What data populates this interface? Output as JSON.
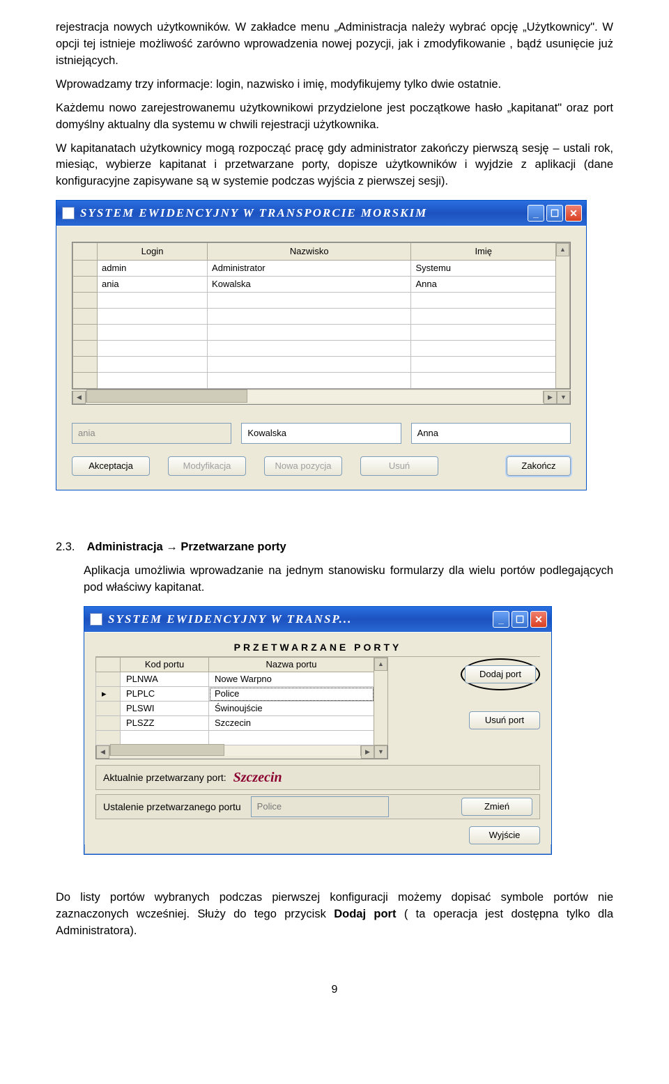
{
  "para1": "rejestracja nowych użytkowników. W zakładce menu „Administracja należy wybrać opcję „Użytkownicy\". W opcji tej istnieje możliwość zarówno wprowadzenia nowej pozycji, jak i zmodyfikowanie , bądź usunięcie już istniejących.",
  "para2": "Wprowadzamy trzy informacje:  login, nazwisko i imię, modyfikujemy tylko dwie ostatnie.",
  "para3": " Każdemu nowo zarejestrowanemu użytkownikowi przydzielone jest początkowe  hasło „kapitanat\" oraz port domyślny aktualny dla systemu w chwili rejestracji użytkownika.",
  "para4": "  W kapitanatach użytkownicy mogą rozpocząć pracę gdy administrator zakończy pierwszą sesję – ustali rok, miesiąc, wybierze kapitanat i przetwarzane porty, dopisze użytkowników  i wyjdzie z aplikacji (dane konfiguracyjne zapisywane są w systemie podczas  wyjścia z pierwszej sesji).",
  "win1": {
    "title": "SYSTEM  EWIDENCYJNY  W  TRANSPORCIE  MORSKIM",
    "cols": [
      "Login",
      "Nazwisko",
      "Imię"
    ],
    "rows": [
      {
        "login": "admin",
        "nazwisko": "Administrator",
        "imie": "Systemu"
      },
      {
        "login": "ania",
        "nazwisko": "Kowalska",
        "imie": "Anna"
      }
    ],
    "edit": {
      "login": "ania",
      "nazwisko": "Kowalska",
      "imie": "Anna"
    },
    "btns": {
      "accept": "Akceptacja",
      "modify": "Modyfikacja",
      "new": "Nowa pozycja",
      "del": "Usuń",
      "close": "Zakończ"
    }
  },
  "sect": {
    "num": "2.3.",
    "title": "Administracja → Przetwarzane porty",
    "body": "Aplikacja umożliwia wprowadzanie na jednym stanowisku formularzy dla wielu portów podlegających pod właściwy kapitanat."
  },
  "win2": {
    "title": "SYSTEM  EWIDENCYJNY  W  TRANSP...",
    "heading": "PRZETWARZANE PORTY",
    "cols": [
      "Kod portu",
      "Nazwa portu"
    ],
    "rows": [
      {
        "kod": "PLNWA",
        "nazwa": "Nowe Warpno"
      },
      {
        "kod": "PLPLC",
        "nazwa": "Police"
      },
      {
        "kod": "PLSWI",
        "nazwa": "Świnoujście"
      },
      {
        "kod": "PLSZZ",
        "nazwa": "Szczecin"
      }
    ],
    "btns": {
      "add": "Dodaj port",
      "del": "Usuń port",
      "change": "Zmień",
      "exit": "Wyjście"
    },
    "cur_lbl": "Aktualnie przetwarzany port:",
    "cur_val": "Szczecin",
    "set_lbl": "Ustalenie przetwarzanego portu",
    "set_val": "Police"
  },
  "para5": "Do listy portów wybranych podczas pierwszej konfiguracji możemy dopisać symbole portów nie zaznaczonych wcześniej. Służy do tego przycisk ",
  "para5b": "Dodaj port",
  "para5c": " ( ta operacja jest dostępna tylko dla Administratora).",
  "page": "9"
}
